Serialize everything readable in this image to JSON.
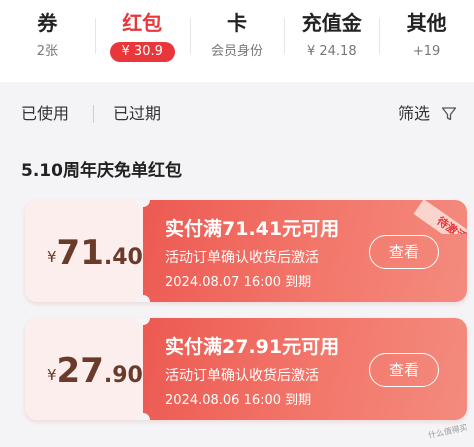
{
  "tabs": [
    {
      "name": "券",
      "sub": "2张"
    },
    {
      "name": "红包",
      "sub": "¥ 30.9",
      "active": true
    },
    {
      "name": "卡",
      "sub": "会员身份"
    },
    {
      "name": "充值金",
      "sub": "¥ 24.18"
    },
    {
      "name": "其他",
      "sub": "+19"
    }
  ],
  "filter": {
    "used": "已使用",
    "expired": "已过期",
    "sort": "筛选"
  },
  "section": {
    "title": "5.10周年庆免单红包"
  },
  "coupons": [
    {
      "currency": "¥",
      "amount_int": "71",
      "amount_dec": ".40",
      "title": "实付满71.41元可用",
      "desc": "活动订单确认收货后激活",
      "expiry": "2024.08.07 16:00 到期",
      "button": "查看",
      "badge": "待激活"
    },
    {
      "currency": "¥",
      "amount_int": "27",
      "amount_dec": ".90",
      "title": "实付满27.91元可用",
      "desc": "活动订单确认收货后激活",
      "expiry": "2024.08.06 16:00 到期",
      "button": "查看"
    }
  ],
  "watermark": "什么值得买",
  "colors": {
    "accent": "#e8363a",
    "card_gradient_start": "#ec5a52",
    "card_gradient_end": "#f38b7e"
  }
}
